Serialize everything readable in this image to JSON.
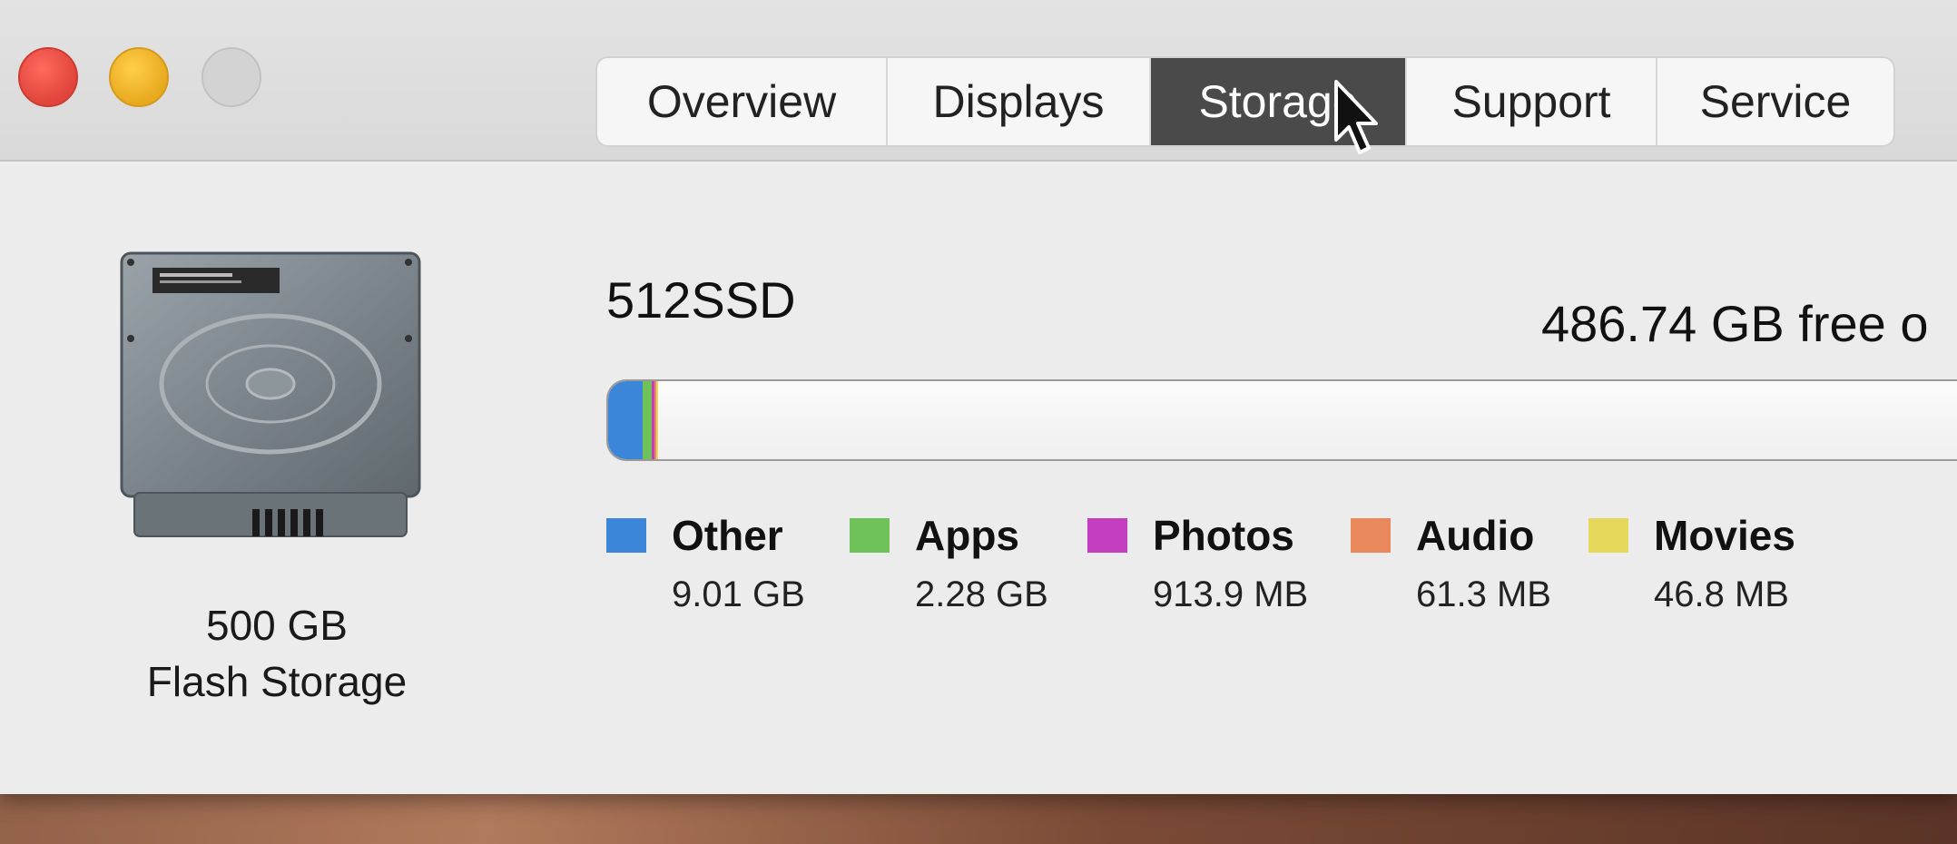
{
  "window": {
    "traffic_lights": [
      "close",
      "minimize",
      "zoom"
    ]
  },
  "tabs": [
    {
      "label": "Overview",
      "active": false
    },
    {
      "label": "Displays",
      "active": false
    },
    {
      "label": "Storage",
      "active": true
    },
    {
      "label": "Support",
      "active": false
    },
    {
      "label": "Service",
      "active": false
    }
  ],
  "drive": {
    "icon": "hard-drive-icon",
    "capacity": "500 GB",
    "type": "Flash Storage"
  },
  "volume": {
    "name": "512SSD",
    "free_text": "486.74 GB free o"
  },
  "usage": {
    "total_gb": 500,
    "categories": [
      {
        "label": "Other",
        "size": "9.01 GB",
        "gb": 9.01,
        "color": "#3b86d8"
      },
      {
        "label": "Apps",
        "size": "2.28 GB",
        "gb": 2.28,
        "color": "#6fc15a"
      },
      {
        "label": "Photos",
        "size": "913.9 MB",
        "gb": 0.9139,
        "color": "#c33fc0"
      },
      {
        "label": "Audio",
        "size": "61.3 MB",
        "gb": 0.0613,
        "color": "#e9885a"
      },
      {
        "label": "Movies",
        "size": "46.8 MB",
        "gb": 0.0468,
        "color": "#e6d85a"
      }
    ]
  }
}
